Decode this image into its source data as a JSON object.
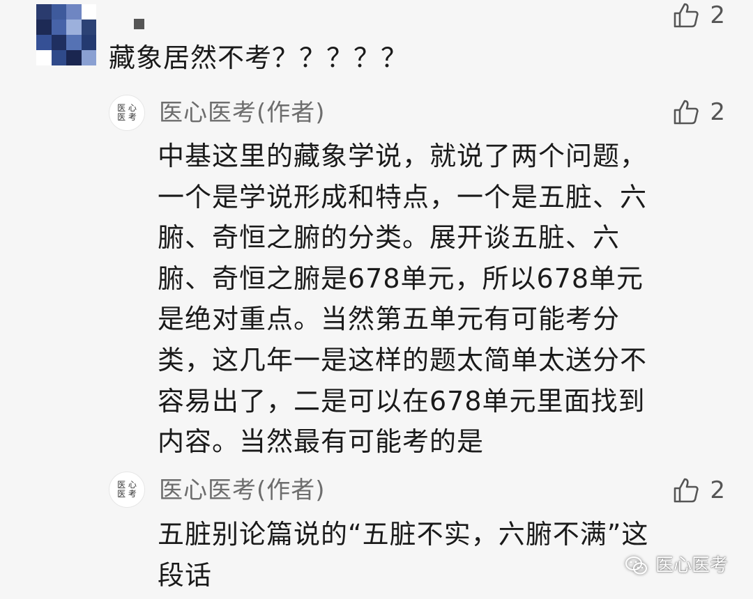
{
  "comment": {
    "text": "藏象居然不考？？？？？",
    "likes": "2",
    "avatar_colors": [
      "#2a3b6e",
      "#3e5a9c",
      "#6f86c2",
      "#ffffff",
      "#1d2a55",
      "#4763a8",
      "#9cb0dc",
      "#2c4275",
      "#355095",
      "#1f2f60",
      "#5572b4",
      "#243a70",
      "#ffffff",
      "#2f4a8a",
      "#1a2650",
      "#8aa0d2"
    ]
  },
  "replies": [
    {
      "author": "医心医考(作者)",
      "avatar_line1": "医 心",
      "avatar_line2": "医 考",
      "likes": "2",
      "lines": [
        "中基这里的藏象学说，就说了两个问题，",
        "一个是学说形成和特点，一个是五脏、六",
        "腑、奇恒之腑的分类。展开谈五脏、六",
        "腑、奇恒之腑是678单元，所以678单元",
        "是绝对重点。当然第五单元有可能考分",
        "类，这几年一是这样的题太简单太送分不",
        "容易出了，二是可以在678单元里面找到",
        "内容。当然最有可能考的是"
      ]
    },
    {
      "author": "医心医考(作者)",
      "avatar_line1": "医 心",
      "avatar_line2": "医 考",
      "likes": "2",
      "lines": [
        "五脏别论篇说的“五脏不实，六腑不满”这",
        "段话"
      ]
    }
  ],
  "watermark": {
    "icon": "wechat-icon",
    "text": "医心医考"
  },
  "colors": {
    "background": "#f6f6f6",
    "text": "#1a1a1a",
    "author": "#6d6d6d",
    "like": "#555555"
  }
}
